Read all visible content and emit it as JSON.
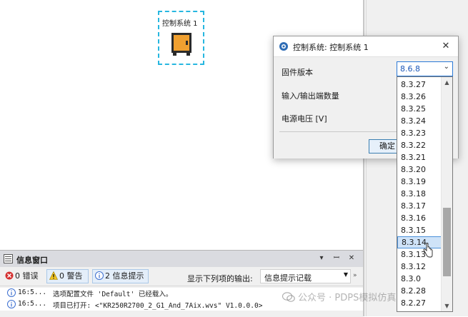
{
  "canvas": {
    "node_label": "控制系统 1"
  },
  "dialog": {
    "title": "控制系统: 控制系统 1",
    "close_glyph": "✕",
    "fields": [
      {
        "label": "固件版本"
      },
      {
        "label": "输入/输出端数量"
      },
      {
        "label": "电源电压 [V]"
      }
    ],
    "ok_button": "确定"
  },
  "firmware_dropdown": {
    "selected": "8.6.8",
    "arrow_glyph": "⌄",
    "options": [
      "8.3.27",
      "8.3.26",
      "8.3.25",
      "8.3.24",
      "8.3.23",
      "8.3.22",
      "8.3.21",
      "8.3.20",
      "8.3.19",
      "8.3.18",
      "8.3.17",
      "8.3.16",
      "8.3.15",
      "8.3.14",
      "8.3.13",
      "8.3.12",
      "8.3.0",
      "8.2.28",
      "8.2.27"
    ],
    "highlighted": "8.3.14",
    "scroll_up_glyph": "▲",
    "scroll_down_glyph": "▼"
  },
  "info_window": {
    "title": "信息窗口",
    "pin_glyph": "▾",
    "dock_glyph": "ꟷ",
    "close_glyph": "✕",
    "filters": {
      "errors": "0 错误",
      "warnings": "0 警告",
      "infos": "2 信息提示"
    },
    "show_label": "显示下列项的输出:",
    "show_select": "信息提示记载",
    "show_select_arrow": "▼",
    "more_glyph": "»",
    "messages": [
      {
        "time": "16:5...",
        "text": "选项配置文件 'Default' 已经载入。"
      },
      {
        "time": "16:5...",
        "text": "项目已打开: <\"KR250R2700_2_G1_And_7Aix.wvs\" V1.0.0.0>"
      }
    ]
  },
  "watermark": {
    "text": "公众号 · PDPS模拟仿真"
  },
  "colors": {
    "selection_border": "#27b7e0",
    "accent_blue": "#2b79d6",
    "cabinet_orange": "#f0a030",
    "info_blue": "#3c6fd0",
    "error_red": "#d43030",
    "warning_yellow": "#f3c623"
  }
}
